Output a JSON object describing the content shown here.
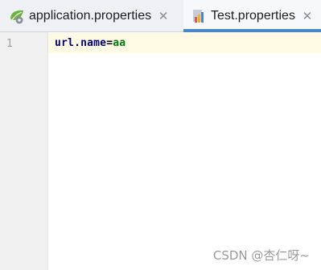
{
  "tabs": [
    {
      "label": "application.properties",
      "icon": "spring-leaf-icon",
      "active": false
    },
    {
      "label": "Test.properties",
      "icon": "properties-file-icon",
      "active": true
    }
  ],
  "editor": {
    "line_numbers": [
      "1"
    ],
    "line": {
      "key": "url.name",
      "separator": "=",
      "value": "aa"
    }
  },
  "watermark": "CSDN @杏仁呀~",
  "colors": {
    "accent": "#4a88c7",
    "key": "#000080",
    "value": "#067d17",
    "current_line": "#fffae3"
  }
}
